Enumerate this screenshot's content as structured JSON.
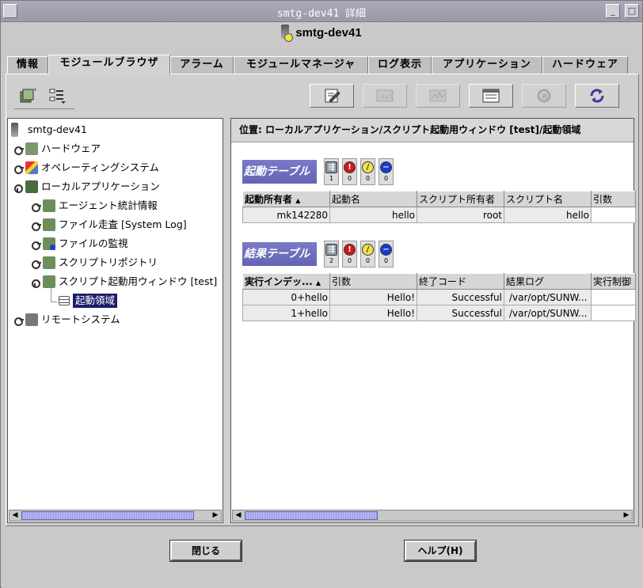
{
  "window": {
    "title": "smtg-dev41 詳細",
    "minimize_label": "_",
    "maximize_label": "□"
  },
  "header": {
    "host": "smtg-dev41"
  },
  "tabs": [
    {
      "label": "情報"
    },
    {
      "label": "モジュールブラウザ",
      "active": true
    },
    {
      "label": "アラーム"
    },
    {
      "label": "モジュールマネージャ"
    },
    {
      "label": "ログ表示"
    },
    {
      "label": "アプリケーション"
    },
    {
      "label": "ハードウェア"
    }
  ],
  "tree": {
    "root": "smtg-dev41",
    "items": [
      {
        "label": "ハードウェア"
      },
      {
        "label": "オペレーティングシステム"
      },
      {
        "label": "ローカルアプリケーション"
      },
      {
        "label": "エージェント統計情報"
      },
      {
        "label": "ファイル走査 [System Log]"
      },
      {
        "label": "ファイルの監視"
      },
      {
        "label": "スクリプトリポジトリ"
      },
      {
        "label": "スクリプト起動用ウィンドウ [test]"
      },
      {
        "label": "起動領域"
      },
      {
        "label": "リモートシステム"
      }
    ]
  },
  "location": {
    "text": "位置:  ローカルアプリケーション/スクリプト起動用ウィンドウ [test]/起動領域"
  },
  "launch_table": {
    "title": "起動テーブル",
    "status_counts": [
      "1",
      "0",
      "0",
      "0"
    ],
    "columns": [
      "起動所有者",
      "起動名",
      "スクリプト所有者",
      "スクリプト名",
      "引数"
    ],
    "rows": [
      [
        "mk142280",
        "hello",
        "root",
        "hello",
        ""
      ]
    ]
  },
  "result_table": {
    "title": "結果テーブル",
    "status_counts": [
      "2",
      "0",
      "0",
      "0"
    ],
    "columns": [
      "実行インデッ...",
      "引数",
      "終了コード",
      "結果ログ",
      "実行制御"
    ],
    "rows": [
      [
        "0+hello",
        "Hello!",
        "Successful",
        "/var/opt/SUNW...",
        ""
      ],
      [
        "1+hello",
        "Hello!",
        "Successful",
        "/var/opt/SUNW...",
        ""
      ]
    ]
  },
  "buttons": {
    "close": "閉じる",
    "help": "ヘルプ(H)"
  },
  "colors": {
    "selection": "#1d1d6b",
    "section_header": "#6a6ab8",
    "titlebar": "#a3a3b4"
  }
}
